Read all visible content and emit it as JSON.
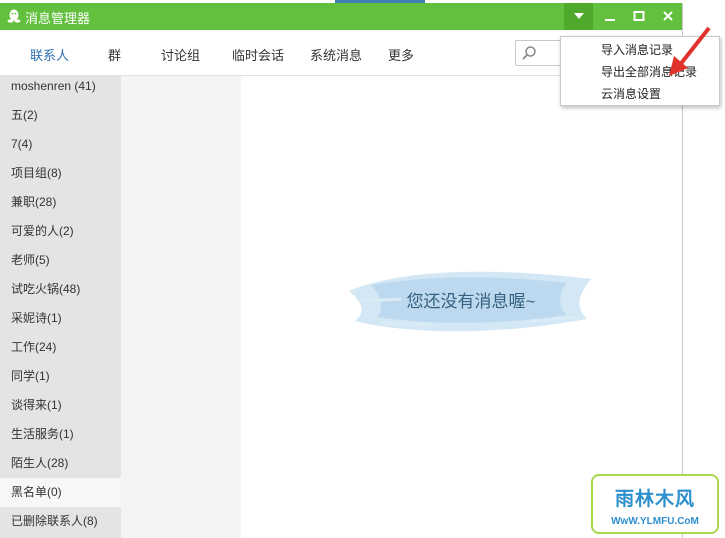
{
  "window": {
    "title": "消息管理器"
  },
  "tabs": [
    {
      "label": "联系人",
      "active": true
    },
    {
      "label": "群"
    },
    {
      "label": "讨论组"
    },
    {
      "label": "临时会话"
    },
    {
      "label": "系统消息"
    },
    {
      "label": "更多"
    }
  ],
  "search": {
    "placeholder": ""
  },
  "sidebar": {
    "items": [
      {
        "label": "moshenren (41)"
      },
      {
        "label": "五(2)"
      },
      {
        "label": "7(4)"
      },
      {
        "label": "项目组(8)"
      },
      {
        "label": "兼职(28)"
      },
      {
        "label": "可爱的人(2)"
      },
      {
        "label": "老师(5)"
      },
      {
        "label": "试吃火锅(48)"
      },
      {
        "label": "采妮诗(1)"
      },
      {
        "label": "工作(24)"
      },
      {
        "label": "同学(1)"
      },
      {
        "label": "谈得来(1)"
      },
      {
        "label": "生活服务(1)"
      },
      {
        "label": "陌生人(28)"
      },
      {
        "label": "黑名单(0)",
        "selected": true
      },
      {
        "label": "已删除联系人(8)"
      }
    ]
  },
  "main": {
    "empty_message": "您还没有消息喔~"
  },
  "menu": {
    "items": [
      {
        "label": "导入消息记录"
      },
      {
        "label": "导出全部消息记录"
      },
      {
        "label": "云消息设置"
      }
    ]
  },
  "watermark": {
    "main": "雨林木风",
    "sub": "WwW.YLMFU.CoM"
  },
  "colors": {
    "titlebar": "#63bf3e",
    "active_tab": "#2b6fb3",
    "sidebar": "#e4e4e4",
    "arrow": "#e0322c"
  },
  "icons": [
    "qq-penguin-icon",
    "dropdown-arrow-icon",
    "minimize-icon",
    "maximize-icon",
    "close-icon",
    "search-icon",
    "pointer-arrow-icon"
  ]
}
